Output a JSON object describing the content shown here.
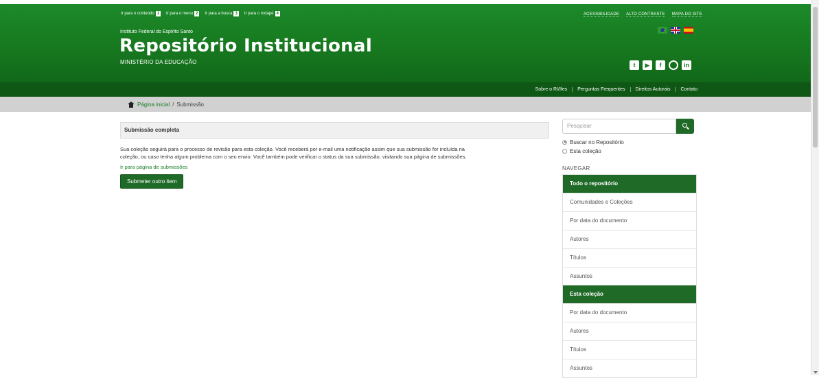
{
  "skip_links": [
    {
      "label": "Ir para o conteúdo",
      "key": "1"
    },
    {
      "label": "Ir para o menu",
      "key": "2"
    },
    {
      "label": "Ir para a busca",
      "key": "3"
    },
    {
      "label": "Ir para o rodapé",
      "key": "4"
    }
  ],
  "top_links": [
    "ACESSIBILIDADE",
    "ALTO CONTRASTE",
    "MAPA DO SITE"
  ],
  "header": {
    "institution": "Instituto Federal do Espírito Santo",
    "title": "Repositório Institucional",
    "ministry": "MINISTÉRIO DA EDUCAÇÃO"
  },
  "nav": [
    "Sobre o RI/Ifes",
    "Perguntas Frequentes",
    "Direitos Autorais",
    "Contato"
  ],
  "breadcrumb": {
    "home": "Página inicial",
    "separator": "/",
    "current": "Submissão"
  },
  "main": {
    "section_title": "Submissão completa",
    "message_line1": "Sua coleção seguirá para o processo de revisão para esta coleção. Você receberá por e-mail uma notificação assim que sua submissão for incluída na",
    "message_line2": "coleção, ou caso tenha algum problema com o seu envio. Você também pode verificar o status da sua submissão, visitando sua página de submissões.",
    "submissions_link": "Ir para página de submissões",
    "submit_button": "Submeter outro item"
  },
  "sidebar": {
    "search_placeholder": "Pesquisar",
    "radios": [
      {
        "label": "Buscar no Repositório",
        "selected": true
      },
      {
        "label": "Esta coleção",
        "selected": false
      }
    ],
    "nav_heading": "NAVEGAR",
    "groups": [
      {
        "title": "Todo o repositório",
        "items": [
          "Comunidades e Coleções",
          "Por data do documento",
          "Autores",
          "Títulos",
          "Assuntos"
        ]
      },
      {
        "title": "Esta coleção",
        "items": [
          "Por data do documento",
          "Autores",
          "Títulos",
          "Assuntos"
        ]
      }
    ]
  },
  "colors": {
    "header_green": "#1c8a2a",
    "nav_dark_green": "#0f5714",
    "accent_green": "#1f6a27",
    "breadcrumb_bg": "#d1d1d1"
  },
  "icons": [
    "twitter-icon",
    "youtube-icon",
    "facebook-icon",
    "instagram-icon",
    "linkedin-icon",
    "home-icon",
    "search-icon"
  ]
}
